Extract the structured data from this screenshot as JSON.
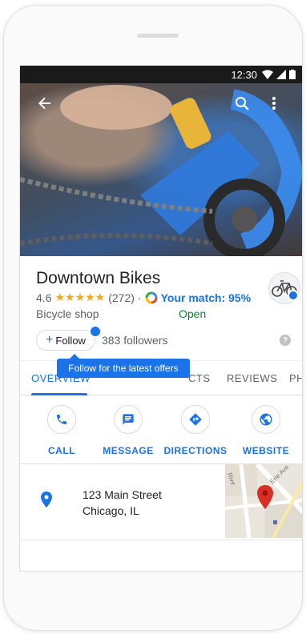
{
  "status_bar": {
    "time": "12:30"
  },
  "place": {
    "name": "Downtown Bikes",
    "rating": "4.6",
    "stars": "★★★★★",
    "review_count": "(272)",
    "separator": "·",
    "match": "Your match: 95%",
    "category": "Bicycle shop",
    "open_status": "Open"
  },
  "follow": {
    "button_label": "Follow",
    "plus": "+",
    "followers": "383 followers",
    "tooltip": "Follow for the latest offers",
    "help": "?"
  },
  "tabs": [
    {
      "label": "OVERVIEW"
    },
    {
      "label": "CTS"
    },
    {
      "label": "REVIEWS"
    },
    {
      "label": "PH"
    }
  ],
  "actions": [
    {
      "label": "CALL",
      "icon": "phone-icon"
    },
    {
      "label": "MESSAGE",
      "icon": "message-icon"
    },
    {
      "label": "DIRECTIONS",
      "icon": "directions-icon"
    },
    {
      "label": "WEBSITE",
      "icon": "globe-icon"
    }
  ],
  "address": {
    "line1": "123 Main Street",
    "line2": "Chicago, IL"
  },
  "map": {
    "street1": "Rive",
    "street2": "Erie Ave"
  },
  "colors": {
    "accent": "#1a73e8",
    "star": "#f4a622",
    "open": "#188038",
    "pin": "#d93025"
  }
}
